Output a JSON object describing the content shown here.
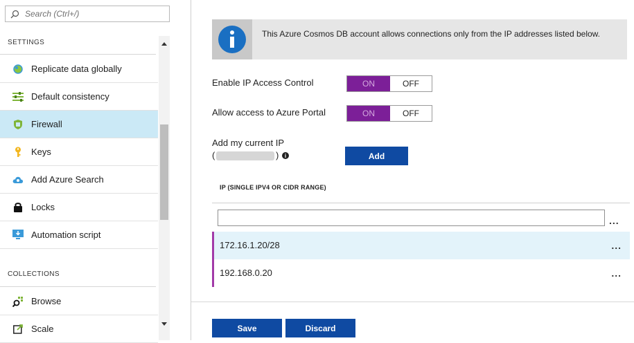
{
  "search": {
    "placeholder": "Search (Ctrl+/)"
  },
  "settings_section": {
    "heading": "SETTINGS",
    "items": [
      {
        "label": "Replicate data globally",
        "icon": "globe-icon"
      },
      {
        "label": "Default consistency",
        "icon": "sliders-icon"
      },
      {
        "label": "Firewall",
        "icon": "shield-icon",
        "selected": true
      },
      {
        "label": "Keys",
        "icon": "key-icon"
      },
      {
        "label": "Add Azure Search",
        "icon": "cloud-icon"
      },
      {
        "label": "Locks",
        "icon": "lock-icon"
      },
      {
        "label": "Automation script",
        "icon": "monitor-download-icon"
      }
    ]
  },
  "collections_section": {
    "heading": "COLLECTIONS",
    "items": [
      {
        "label": "Browse",
        "icon": "browse-icon"
      },
      {
        "label": "Scale",
        "icon": "scale-icon"
      }
    ]
  },
  "info_banner": {
    "text": "This Azure Cosmos DB account allows connections only from the IP addresses listed below."
  },
  "ip_access_control": {
    "label": "Enable IP Access Control",
    "on_label": "ON",
    "off_label": "OFF",
    "value": "ON"
  },
  "azure_portal_access": {
    "label": "Allow access to Azure Portal",
    "on_label": "ON",
    "off_label": "OFF",
    "value": "ON"
  },
  "add_current_ip": {
    "label": "Add my current IP",
    "paren_open": "(",
    "paren_close": ")",
    "info_glyph": "i",
    "button_label": "Add"
  },
  "ip_table": {
    "column_header": "IP (SINGLE IPV4 OR CIDR RANGE)",
    "input_value": "",
    "more_label": "...",
    "rows": [
      {
        "value": "172.16.1.20/28",
        "highlighted": true
      },
      {
        "value": "192.168.0.20",
        "highlighted": false
      }
    ]
  },
  "footer": {
    "save_label": "Save",
    "discard_label": "Discard"
  },
  "colors": {
    "toggle_on": "#7c1f98",
    "button": "#0f4aa2",
    "selected_item": "#cbe9f6",
    "row_accent": "#a23aa8",
    "info_icon": "#1a6fc2"
  }
}
